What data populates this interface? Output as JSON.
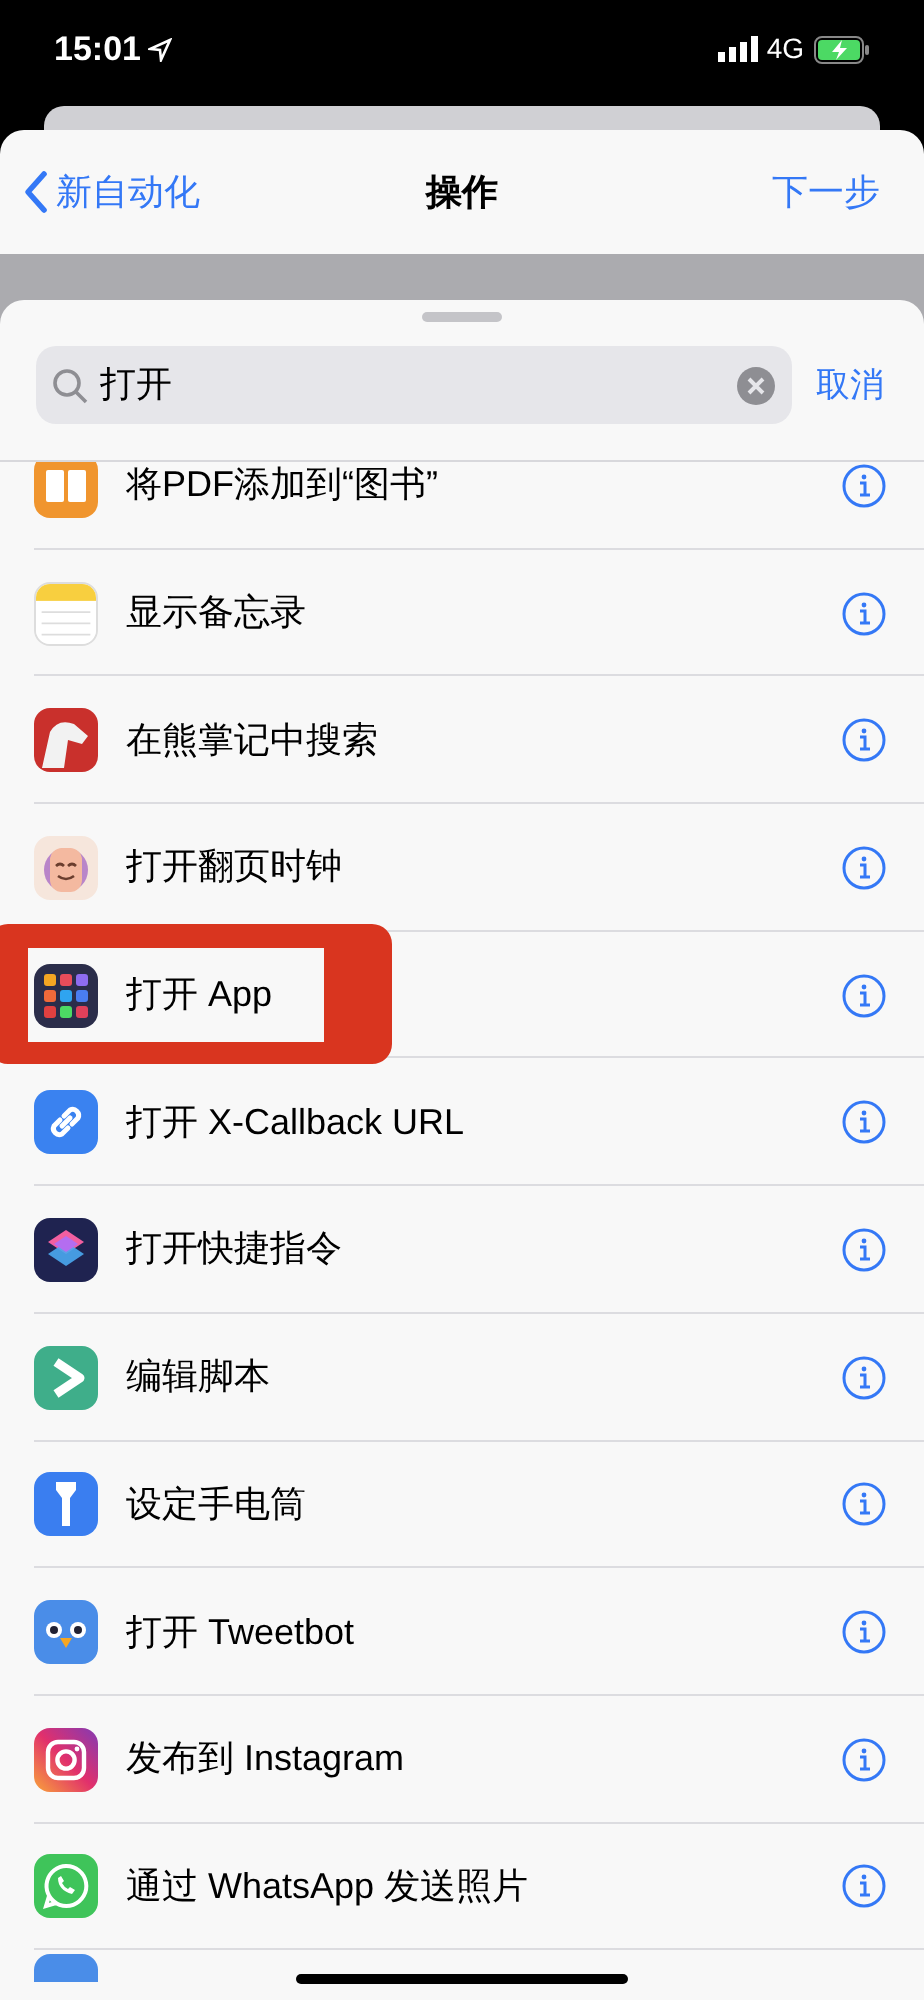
{
  "status_bar": {
    "time": "15:01",
    "network": "4G"
  },
  "nav": {
    "back": "新自动化",
    "title": "操作",
    "next": "下一步"
  },
  "search": {
    "value": "打开",
    "cancel": "取消"
  },
  "actions": [
    {
      "label": "将PDF添加到“图书”"
    },
    {
      "label": "显示备忘录"
    },
    {
      "label": "在熊掌记中搜索"
    },
    {
      "label": "打开翻页时钟"
    },
    {
      "label": "打开 App"
    },
    {
      "label": "打开 X-Callback URL"
    },
    {
      "label": "打开快捷指令"
    },
    {
      "label": "编辑脚本"
    },
    {
      "label": "设定手电筒"
    },
    {
      "label": "打开 Tweetbot"
    },
    {
      "label": "发布到 Instagram"
    },
    {
      "label": "通过 WhatsApp 发送照片"
    }
  ]
}
